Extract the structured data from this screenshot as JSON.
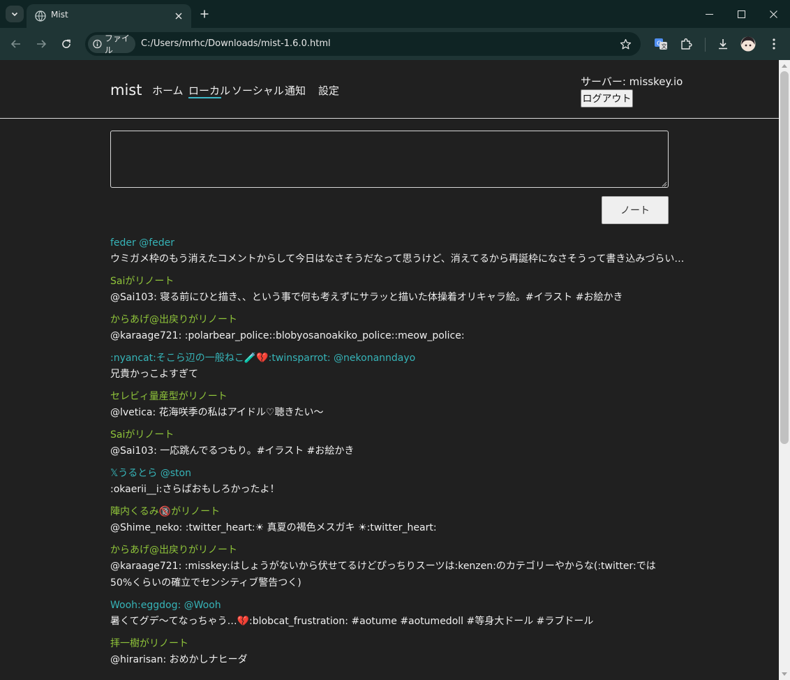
{
  "browser": {
    "tab_title": "Mist",
    "address_chip": "ファイル",
    "url": "C:/Users/mrhc/Downloads/mist-1.6.0.html"
  },
  "site": {
    "brand": "mist",
    "nav": [
      {
        "label": "ホーム",
        "active": false
      },
      {
        "label": "ローカル",
        "active": true
      },
      {
        "label": "ソーシャル",
        "active": false
      },
      {
        "label": "通知",
        "active": false
      },
      {
        "label": "設定",
        "active": false
      }
    ],
    "server_label": "サーバー: misskey.io",
    "logout_label": "ログアウト",
    "compose_value": "",
    "note_button_label": "ノート",
    "accent_color": "#3eb8c8",
    "user_name_color": "#36b4b8",
    "renote_color": "#8fc43a"
  },
  "timeline": [
    {
      "type": "user",
      "head": "feder @feder",
      "body": "ウミガメ枠のもう消えたコメントからして今日はなさそうだなって思うけど、消えてるから再誕枠になさそうって書き込みづらい…"
    },
    {
      "type": "renote",
      "head": "Saiがリノート",
      "body": "@Sai103: 寝る前にひと描き、、という事で何も考えずにサラッと描いた体操着オリキャラ絵。#イラスト #お絵かき"
    },
    {
      "type": "renote",
      "head": "からあげ@出戻りがリノート",
      "body": "@karaage721: :polarbear_police::blobyosanoakiko_police::meow_police:"
    },
    {
      "type": "user",
      "head": ":nyancat:そこら辺の一般ねこ🧪💔:twinsparrot: @nekonanndayo",
      "body": "兄貴かっこよすぎて"
    },
    {
      "type": "renote",
      "head": "セレビィ量産型がリノート",
      "body": "@lvetica: 花海咲季の私はアイドル♡聴きたい〜"
    },
    {
      "type": "renote",
      "head": "Saiがリノート",
      "body": "@Sai103: 一応跳んでるつもり。#イラスト #お絵かき"
    },
    {
      "type": "user",
      "head": "𝕏うるとら @ston",
      "body": ":okaerii__i:さらばおもしろかったよ！"
    },
    {
      "type": "renote",
      "head": "陣内くるみ🔞がリノート",
      "body": "@Shime_neko: :twitter_heart:☀ 真夏の褐色メスガキ ☀:twitter_heart:"
    },
    {
      "type": "renote",
      "head": "からあげ@出戻りがリノート",
      "body": "@karaage721: :misskey:はしょうがないから伏せてるけどぴっちりスーツは:kenzen:のカテゴリーやからな(:twitter:では50%くらいの確立でセンシティブ警告つく)",
      "wrap": true
    },
    {
      "type": "user",
      "head": "Wooh:eggdog: @Wooh",
      "body": "暑くてグデ〜てなっちゃう…💔:blobcat_frustration: #aotume #aotumedoll #等身大ドール #ラブドール"
    },
    {
      "type": "renote",
      "head": "拝一樹がリノート",
      "body": "@hirarisan: おめかしナヒーダ"
    }
  ]
}
